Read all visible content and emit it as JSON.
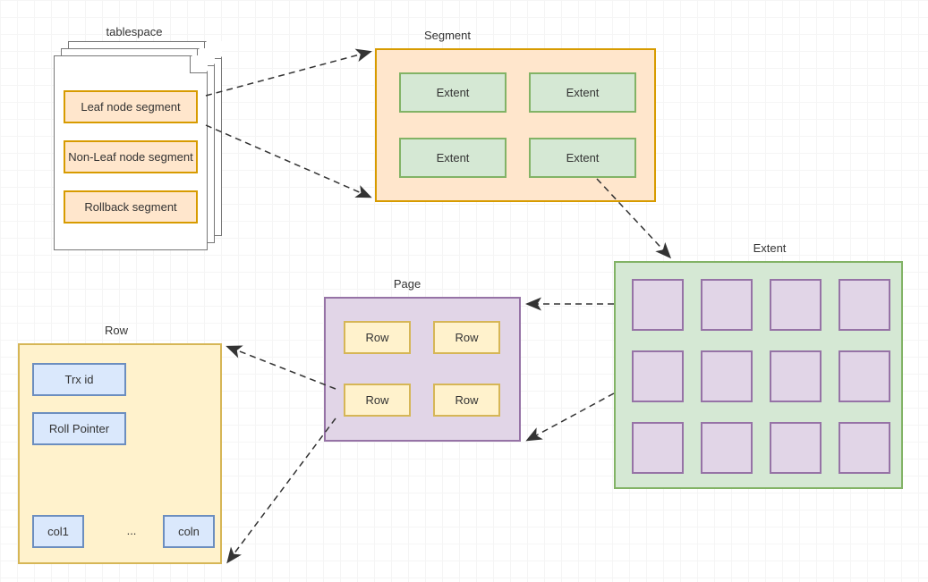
{
  "tablespace": {
    "title": "tablespace",
    "item1": "Leaf node segment",
    "item2": "Non-Leaf node segment",
    "item3": "Rollback segment"
  },
  "segment": {
    "title": "Segment",
    "ext1": "Extent",
    "ext2": "Extent",
    "ext3": "Extent",
    "ext4": "Extent"
  },
  "extent": {
    "title": "Extent"
  },
  "page": {
    "title": "Page",
    "r1": "Row",
    "r2": "Row",
    "r3": "Row",
    "r4": "Row"
  },
  "row": {
    "title": "Row",
    "trxid": "Trx id",
    "rollptr": "Roll Pointer",
    "col1": "col1",
    "dots": "...",
    "coln": "coln"
  }
}
